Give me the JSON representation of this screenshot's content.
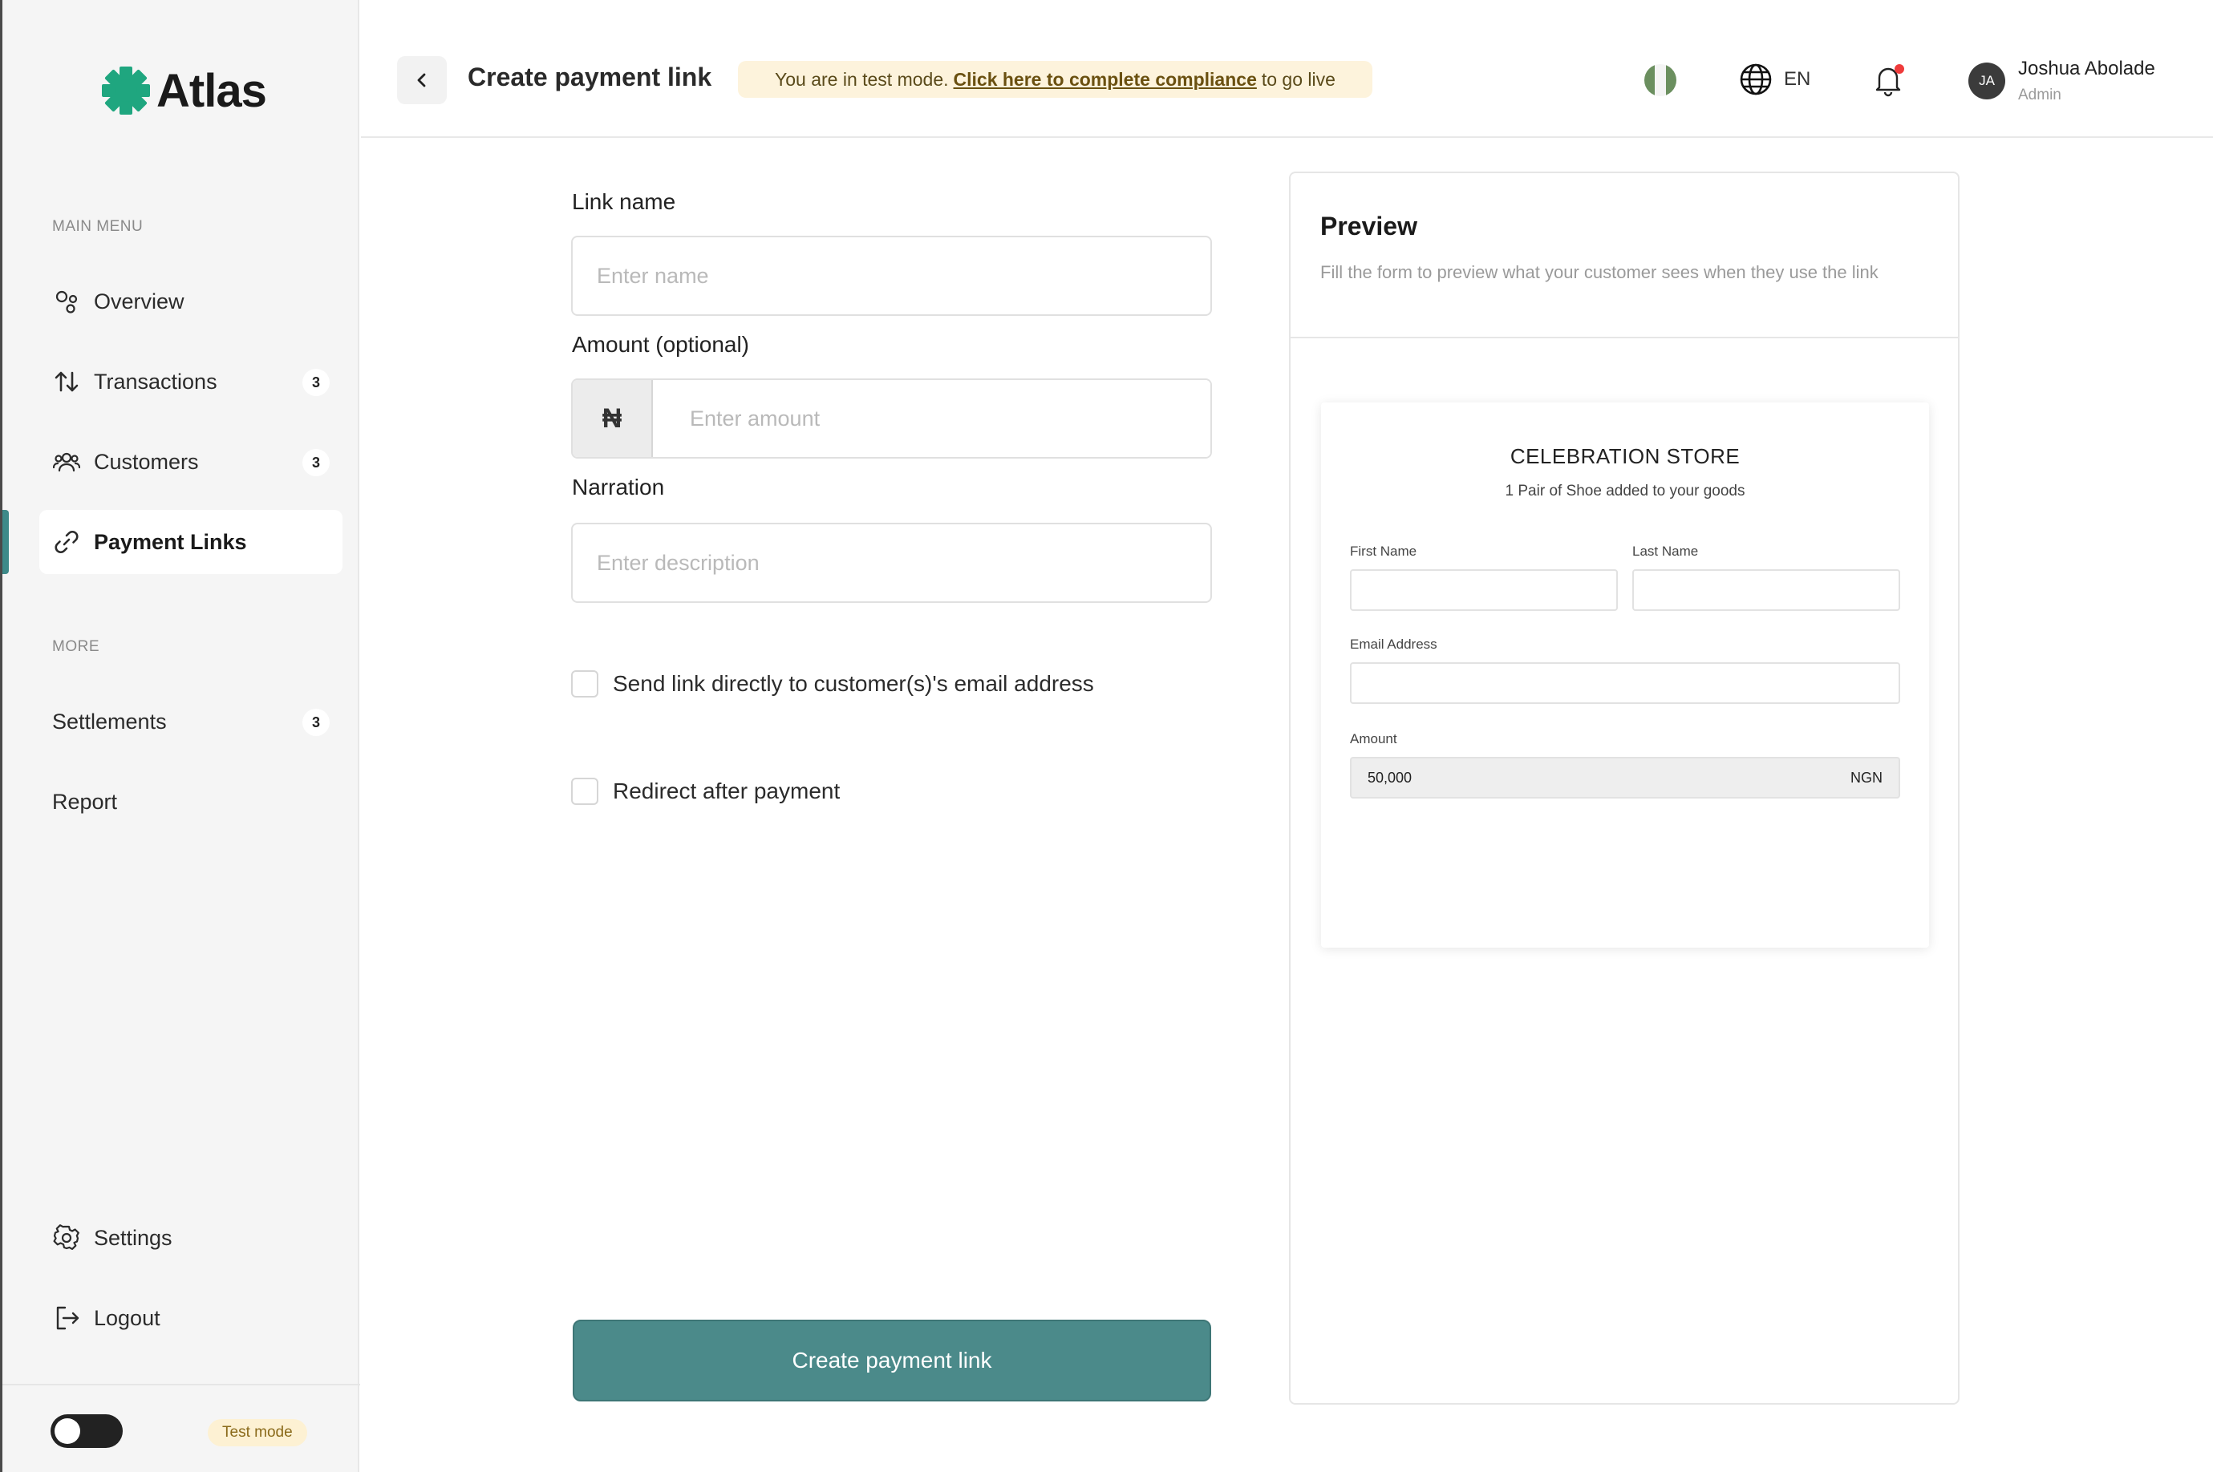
{
  "brand": {
    "name": "Atlas",
    "accent": "#3d8a89",
    "logo_color": "#1fa67f"
  },
  "sidebar": {
    "main_menu_label": "MAIN MENU",
    "items": [
      {
        "label": "Overview",
        "icon": "overview-icon"
      },
      {
        "label": "Transactions",
        "icon": "transactions-icon",
        "badge": "3"
      },
      {
        "label": "Customers",
        "icon": "customers-icon",
        "badge": "3"
      },
      {
        "label": "Payment Links",
        "icon": "link-icon",
        "active": true
      }
    ],
    "more_label": "MORE",
    "more_items": [
      {
        "label": "Settlements",
        "badge": "3"
      },
      {
        "label": "Report"
      }
    ],
    "bottom_items": [
      {
        "label": "Settings",
        "icon": "gear-icon"
      },
      {
        "label": "Logout",
        "icon": "logout-icon"
      }
    ],
    "test_mode_label": "Test mode"
  },
  "header": {
    "title": "Create payment link",
    "banner": {
      "prefix": "You are in test mode.",
      "link": "Click here to complete compliance",
      "suffix": "to go live"
    },
    "language": "EN",
    "user": {
      "initials": "JA",
      "name": "Joshua Abolade",
      "role": "Admin"
    }
  },
  "form": {
    "link_name": {
      "label": "Link name",
      "placeholder": "Enter name",
      "value": ""
    },
    "amount": {
      "label": "Amount (optional)",
      "currency_symbol": "₦",
      "placeholder": "Enter amount",
      "value": ""
    },
    "narration": {
      "label": "Narration",
      "placeholder": "Enter description",
      "value": ""
    },
    "send_email_label": "Send link directly to customer(s)'s email address",
    "send_email_checked": false,
    "redirect_label": "Redirect after payment",
    "redirect_checked": false,
    "submit_label": "Create payment link"
  },
  "preview": {
    "title": "Preview",
    "subtitle": "Fill the form to preview what your customer sees when they use the link",
    "store_name": "CELEBRATION STORE",
    "store_description": "1 Pair of Shoe added to your goods",
    "first_name_label": "First Name",
    "last_name_label": "Last Name",
    "email_label": "Email Address",
    "amount_label": "Amount",
    "amount_value": "50,000",
    "amount_currency": "NGN"
  }
}
